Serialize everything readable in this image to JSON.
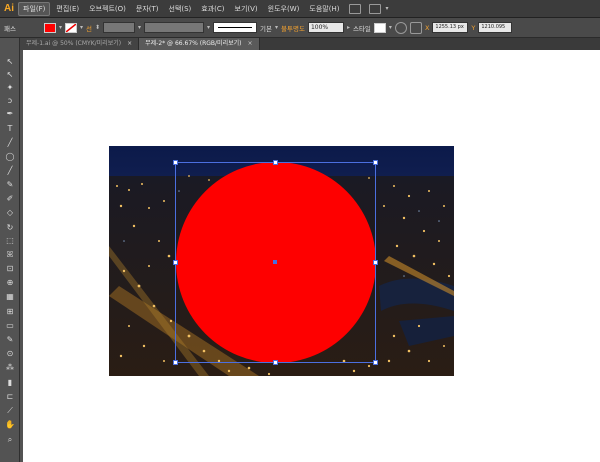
{
  "app": {
    "logo": "Ai"
  },
  "menu": [
    {
      "label": "파일(F)",
      "active": true
    },
    {
      "label": "편집(E)"
    },
    {
      "label": "오브젝트(O)"
    },
    {
      "label": "문자(T)"
    },
    {
      "label": "선택(S)"
    },
    {
      "label": "효과(C)"
    },
    {
      "label": "보기(V)"
    },
    {
      "label": "윈도우(W)"
    },
    {
      "label": "도움말(H)"
    }
  ],
  "control": {
    "object_type": "패스",
    "fill_color": "#ff0000",
    "stroke_label": "선",
    "stroke_style": "기본",
    "opacity_label": "불투명도",
    "opacity_value": "100%",
    "style_label": "스타일",
    "x_value": "1255.13 px",
    "y_value": "1210.095"
  },
  "tabs": [
    {
      "label": "무제-1.ai @ 50% (CMYK/미리보기)",
      "close": "×",
      "active": false
    },
    {
      "label": "무제-2* @ 66.67% (RGB/미리보기)",
      "close": "×",
      "active": true
    }
  ],
  "tools": [
    "selection-tool",
    "direct-selection-tool",
    "magic-wand-tool",
    "lasso-tool",
    "pen-tool",
    "type-tool",
    "line-tool",
    "ellipse-tool",
    "paintbrush-tool",
    "pencil-tool",
    "blob-brush-tool",
    "eraser-tool",
    "rotate-tool",
    "scale-tool",
    "warp-tool",
    "free-transform-tool",
    "shape-builder-tool",
    "perspective-grid-tool",
    "mesh-tool",
    "gradient-tool",
    "eyedropper-tool",
    "blend-tool",
    "symbol-sprayer-tool",
    "column-graph-tool",
    "artboard-tool",
    "slice-tool",
    "hand-tool",
    "zoom-tool"
  ],
  "canvas": {
    "circle_color": "#fe0000",
    "selection_color": "#4b6fe0"
  }
}
